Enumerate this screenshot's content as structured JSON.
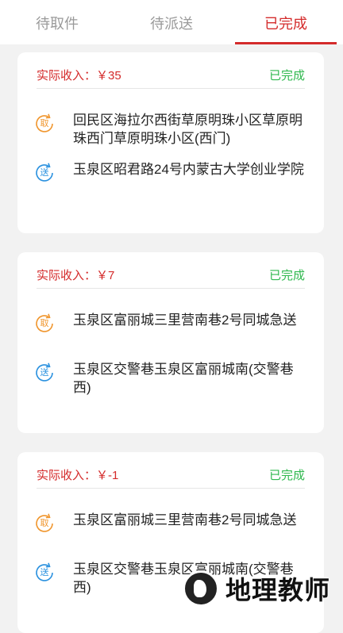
{
  "tabs": [
    {
      "label": "待取件"
    },
    {
      "label": "待派送"
    },
    {
      "label": "已完成"
    }
  ],
  "active_tab": "已完成",
  "pickup_badge": "取",
  "deliver_badge": "送",
  "orders": [
    {
      "income": "实际收入：￥35",
      "status": "已完成",
      "pickup": "回民区海拉尔西街草原明珠小区草原明珠西门草原明珠小区(西门)",
      "delivery": "玉泉区昭君路24号内蒙古大学创业学院"
    },
    {
      "income": "实际收入：￥7",
      "status": "已完成",
      "pickup": "玉泉区富丽城三里营南巷2号同城急送",
      "delivery": "玉泉区交警巷玉泉区富丽城南(交警巷西)"
    },
    {
      "income": "实际收入：￥-1",
      "status": "已完成",
      "pickup": "玉泉区富丽城三里营南巷2号同城急送",
      "delivery": "玉泉区交警巷玉泉区富丽城南(交警巷西)"
    }
  ],
  "watermark": "地理教师",
  "colors": {
    "accent": "#d42b2b",
    "status": "#2fb84e",
    "pickup": "#f0962e",
    "deliver": "#2a91df"
  }
}
